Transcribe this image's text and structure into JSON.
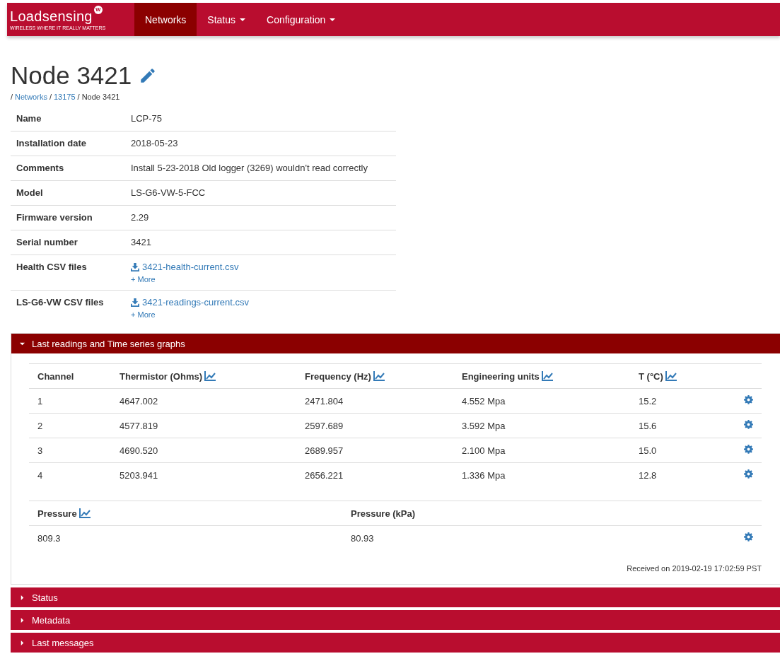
{
  "navbar": {
    "logo": {
      "name": "Loadsensing",
      "badge": "w",
      "tagline": "WIRELESS WHERE IT REALLY MATTERS"
    },
    "items": [
      {
        "label": "Networks",
        "selected": true,
        "dropdown": false
      },
      {
        "label": "Status",
        "selected": false,
        "dropdown": true
      },
      {
        "label": "Configuration",
        "selected": false,
        "dropdown": true
      }
    ]
  },
  "title": "Node 3421",
  "breadcrumb": [
    {
      "separator": "/",
      "label": "Networks",
      "link": true
    },
    {
      "separator": "/",
      "label": "13175",
      "link": true
    },
    {
      "separator": "/",
      "label": "Node 3421",
      "link": false
    }
  ],
  "details": [
    {
      "label": "Name",
      "value": "LCP-75"
    },
    {
      "label": "Installation date",
      "value": "2018-05-23"
    },
    {
      "label": "Comments",
      "value": "Install 5-23-2018 Old logger (3269) wouldn't read correctly"
    },
    {
      "label": "Model",
      "value": "LS-G6-VW-5-FCC"
    },
    {
      "label": "Firmware version",
      "value": "2.29"
    },
    {
      "label": "Serial number",
      "value": "3421"
    },
    {
      "label": "Health CSV files",
      "file": "3421-health-current.csv",
      "more": "+ More"
    },
    {
      "label": "LS-G6-VW CSV files",
      "file": "3421-readings-current.csv",
      "more": "+ More"
    }
  ],
  "panels": [
    {
      "title": "Last readings and Time series graphs",
      "expanded": true,
      "readings": {
        "columns": [
          {
            "label": "Channel",
            "chart": false
          },
          {
            "label": "Thermistor (Ohms)",
            "chart": true
          },
          {
            "label": "Frequency (Hz)",
            "chart": true
          },
          {
            "label": "Engineering units",
            "chart": true
          },
          {
            "label": "T (°C)",
            "chart": true
          }
        ],
        "rows": [
          [
            "1",
            "4647.002",
            "2471.804",
            "4.552 Mpa",
            "15.2"
          ],
          [
            "2",
            "4577.819",
            "2597.689",
            "3.592 Mpa",
            "15.6"
          ],
          [
            "3",
            "4690.520",
            "2689.957",
            "2.100 Mpa",
            "15.0"
          ],
          [
            "4",
            "5203.941",
            "2656.221",
            "1.336 Mpa",
            "12.8"
          ]
        ]
      },
      "pressure": {
        "columns": [
          {
            "label": "Pressure",
            "chart": true
          },
          {
            "label": "Pressure (kPa)",
            "chart": false
          }
        ],
        "rows": [
          [
            "809.3",
            "80.93"
          ]
        ]
      },
      "received": "Received on 2019-02-19 17:02:59 PST"
    },
    {
      "title": "Status",
      "expanded": false
    },
    {
      "title": "Metadata",
      "expanded": false
    },
    {
      "title": "Last messages",
      "expanded": false
    }
  ]
}
